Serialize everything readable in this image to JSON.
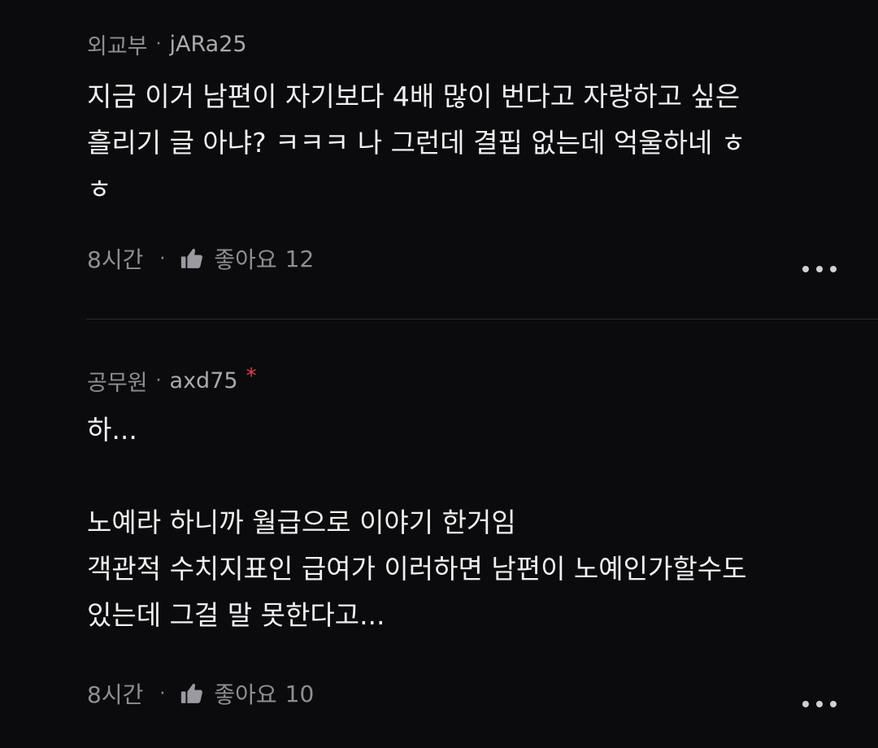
{
  "comments": [
    {
      "department": "외교부",
      "separator": "·",
      "nickname": "jARa25",
      "starred": false,
      "text": "지금 이거 남편이 자기보다 4배 많이 번다고 자랑하고 싶은\n흘리기 글 아냐? ㅋㅋㅋ 나 그런데 결핍 없는데 억울하네 ㅎ\nㅎ",
      "time": "8시간",
      "like_label": "좋아요",
      "like_count": "12"
    },
    {
      "department": "공무원",
      "separator": "·",
      "nickname": "axd75",
      "star": "*",
      "starred": true,
      "text": "하...\n\n노예라 하니까 월급으로 이야기 한거임\n객관적 수치지표인 급여가 이러하면 남편이 노예인가할수도\n있는데 그걸 말 못한다고...",
      "time": "8시간",
      "like_label": "좋아요",
      "like_count": "10"
    }
  ],
  "icons": {
    "like": "thumbs-up-icon",
    "more": "more-dots-icon"
  },
  "colors": {
    "background": "#0b0b0d",
    "text": "#f0f0f0",
    "muted": "#8e8e93",
    "star": "#e0414d",
    "divider": "#2c2c30"
  }
}
